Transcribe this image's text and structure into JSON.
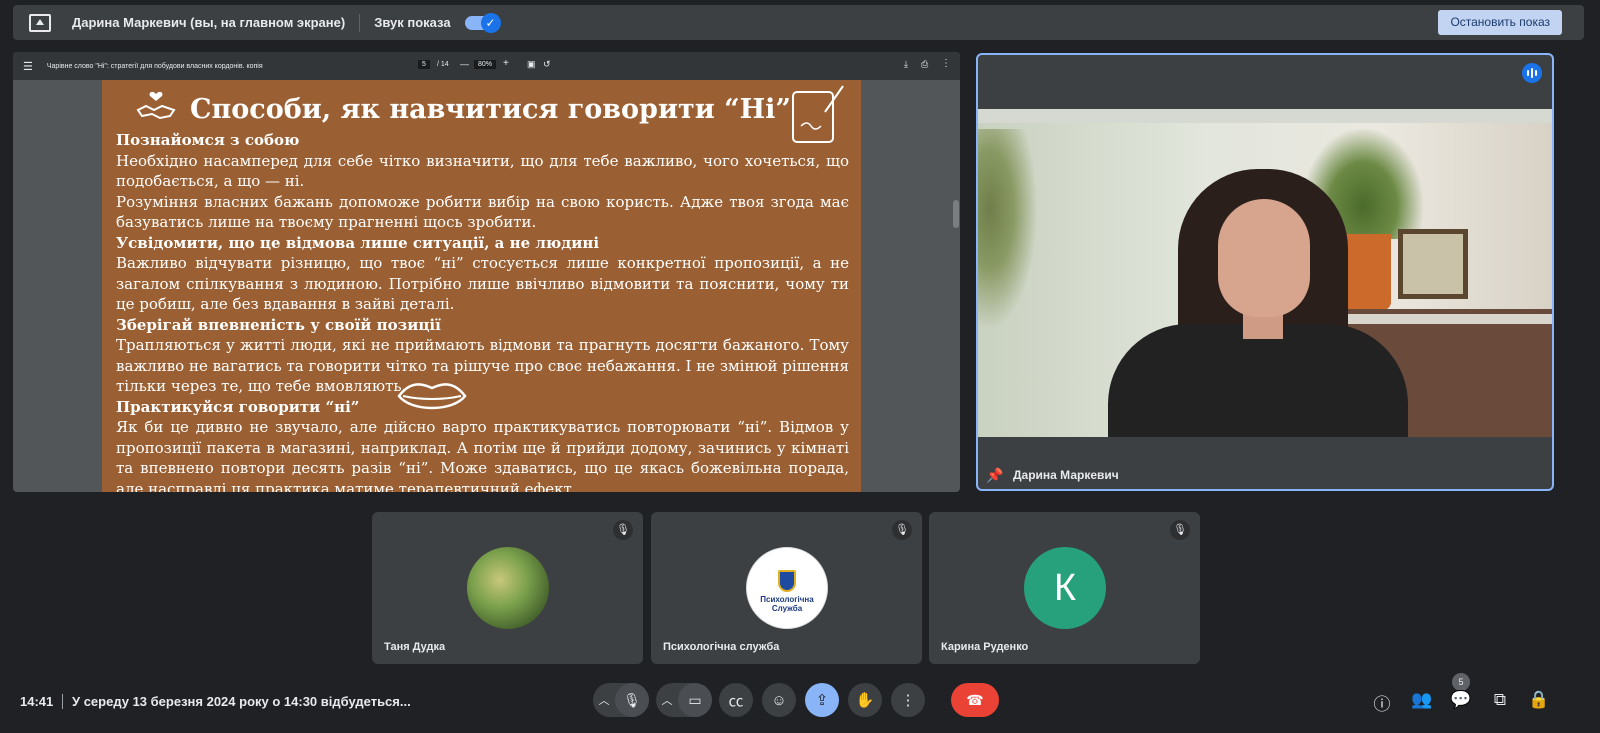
{
  "topbar": {
    "presenter": "Дарина Маркевич (вы, на главном экране)",
    "sound_label": "Звук показа",
    "stop_button": "Остановить показ"
  },
  "pdf": {
    "filename": "Чарівне слово \"Ні\": стратегії для побудови власних кордонів. копія",
    "page_current": "5",
    "page_total": "/ 14",
    "zoom": "80%",
    "title": "Способи, як навчитися говорити “Ні”",
    "sections": [
      {
        "heading": "Познайомся з собою",
        "text": "Необхідно насамперед для себе чітко визначити, що для тебе важливо, чого хочеться, що подобається, а що — ні.\nРозуміння власних бажань допоможе робити вибір на свою користь. Адже твоя згода має базуватись лише на твоєму прагненні щось зробити."
      },
      {
        "heading": "Усвідомити, що це відмова лише ситуації, а не людині",
        "text": "Важливо відчувати різницю, що твоє “ні” стосується лише конкретної пропозиції, а не загалом спілкування з людиною. Потрібно лише ввічливо відмовити та пояснити, чому ти це робиш, але без вдавання в зайві деталі."
      },
      {
        "heading": "Зберігай впевненість у своїй позиції",
        "text": "Трапляються у житті люди, які не приймають відмови та прагнуть досягти бажаного. Тому важливо не вагатись та говорити чітко та рішуче про своє небажання. І не змінюй рішення тільки через те, що тебе вмовляють."
      },
      {
        "heading": "Практикуйся говорити “ні”",
        "text": "Як би це дивно не звучало, але дійсно варто практикуватись повторювати “ні”. Відмов у пропозиції пакета в магазині, наприклад. А потім ще й прийди додому, зачинись у кімнаті та впевнено повтори десять разів “ні”. Може здаватись, що це якась божевільна порада, але насправді ця практика матиме терапевтичний ефект."
      }
    ]
  },
  "main_cam": {
    "name": "Дарина Маркевич"
  },
  "tiles": [
    {
      "name": "Таня Дудка"
    },
    {
      "name": "Психологічна служба",
      "avatar_text": "Психологічна Служба"
    },
    {
      "name": "Карина Руденко",
      "initial": "К"
    }
  ],
  "bottom": {
    "time": "14:41",
    "meeting_title": "У середу 13 березня 2024 року о 14:30 відбудеться...",
    "people_count": "5"
  },
  "colors": {
    "accent": "#8ab4f8",
    "end_call": "#ea4335",
    "slide_bg": "#9a6033"
  }
}
